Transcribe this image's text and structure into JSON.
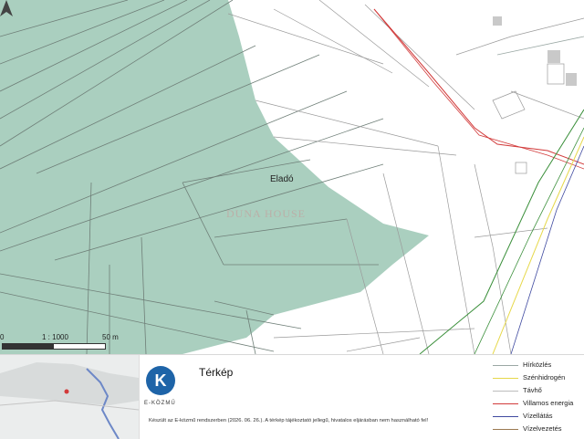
{
  "map": {
    "area_label": "Eladó",
    "watermark": "DUNA HOUSE",
    "scale": {
      "left": "0",
      "mid": "1 : 1000",
      "right": "50 m"
    }
  },
  "info": {
    "logo_letter": "K",
    "logo_text": "E-KÖZMŰ",
    "title": "Térkép",
    "footnote": "Készült az E-közmű rendszerben (2026. 06. 26.). A térkép tájékoztató jellegű, hivatalos eljárásban nem használható fel!"
  },
  "legend": [
    {
      "label": "Hírközlés",
      "color": "#9aa8a4"
    },
    {
      "label": "Szénhidrogén",
      "color": "#e6d84a"
    },
    {
      "label": "Távhő",
      "color": "#bdbdbd"
    },
    {
      "label": "Villamos energia",
      "color": "#d23b3b"
    },
    {
      "label": "Vízellátás",
      "color": "#3f4aa0"
    },
    {
      "label": "Vízelvezetés",
      "color": "#9b7a52"
    }
  ],
  "colors": {
    "green_area": "#9bc7b4",
    "parcel_lines": "#8c8c8c"
  }
}
